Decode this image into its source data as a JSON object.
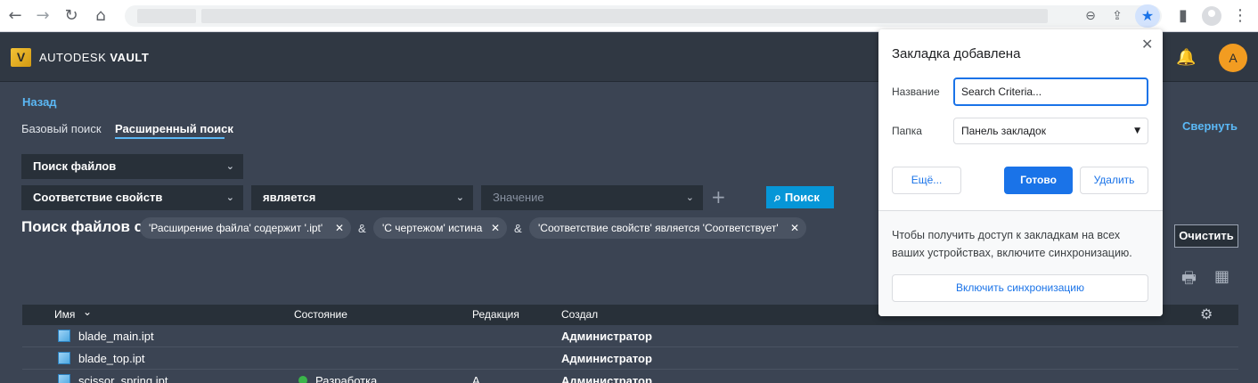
{
  "browser": {
    "back_icon": "←",
    "forward_icon": "→",
    "reload_icon": "↻",
    "home_icon": "⌂",
    "zoom_icon": "⊖",
    "share_icon": "⇪",
    "star_icon": "★",
    "sidepanel_icon": "▮",
    "menu_icon": "⋮"
  },
  "vault": {
    "logo_letter": "V",
    "brand_prefix": "AUTODESK",
    "brand_name": "VAULT",
    "bell_icon": "🔔",
    "avatar_letter": "A",
    "back_link": "Назад",
    "tabs": [
      {
        "label": "Базовый поиск",
        "active": false
      },
      {
        "label": "Расширенный поиск",
        "active": true
      }
    ],
    "collapse_label": "Свернуть",
    "search_type": "Поиск файлов",
    "property_select": "Соответствие свойств",
    "operator_select": "является",
    "value_placeholder": "Значение",
    "plus_icon": "+",
    "search_button": "Поиск",
    "search_icon": "⌕",
    "filter_title": "Поиск файлов с",
    "chips": [
      "'Расширение файла' содержит '.ipt'",
      "'С чертежом' истина",
      "'Соответствие свойств' является 'Соответствует'"
    ],
    "amp": "&",
    "remove_icon": "✕",
    "clear_button": "Очистить",
    "print_icon": "🖶",
    "calc_icon": "▦",
    "table": {
      "headers": [
        "Имя",
        "Состояние",
        "Редакция",
        "Создал"
      ],
      "sort_icon": "⌄",
      "gear_icon": "⚙",
      "rows": [
        {
          "name": "blade_main.ipt",
          "state": "",
          "revision": "",
          "created_by": "Администратор"
        },
        {
          "name": "blade_top.ipt",
          "state": "",
          "revision": "",
          "created_by": "Администратор"
        },
        {
          "name": "scissor_spring.ipt",
          "state": "Разработка",
          "revision": "A",
          "created_by": "Администратор"
        }
      ]
    }
  },
  "bookmark_popup": {
    "title": "Закладка добавлена",
    "close_icon": "✕",
    "name_label": "Название",
    "name_value": "Search Criteria...",
    "folder_label": "Папка",
    "folder_value": "Панель закладок",
    "more_button": "Ещё...",
    "done_button": "Готово",
    "delete_button": "Удалить",
    "sync_note": "Чтобы получить доступ к закладкам на всех ваших устройствах, включите синхронизацию.",
    "sync_button": "Включить синхронизацию"
  }
}
